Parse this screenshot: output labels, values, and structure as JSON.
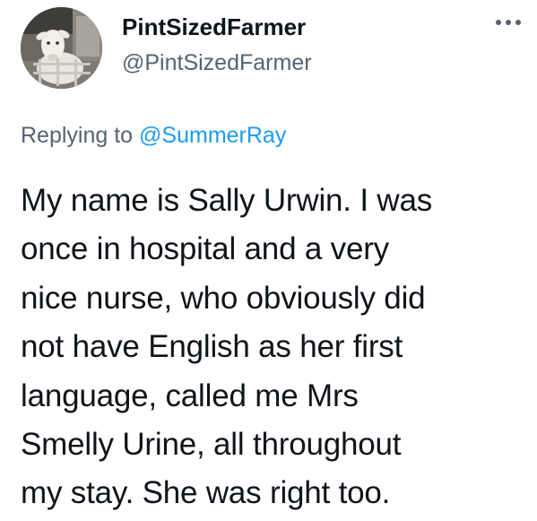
{
  "author": {
    "display_name": "PintSizedFarmer",
    "handle": "@PintSizedFarmer",
    "avatar_icon": "sheep-avatar"
  },
  "reply": {
    "prefix": "Replying to",
    "mention": "@SummerRay"
  },
  "tweet": {
    "lines": [
      "My name is Sally Urwin. I was",
      "once in hospital and a very",
      "nice nurse, who obviously did",
      "not have English as her first",
      "language, called me Mrs",
      "Smelly Urine, all throughout",
      "my stay. She was right too."
    ]
  },
  "menu": {
    "icon": "more-options-icon"
  },
  "colors": {
    "text_primary": "#0f1419",
    "text_secondary": "#536471",
    "link": "#1d9bf0"
  }
}
